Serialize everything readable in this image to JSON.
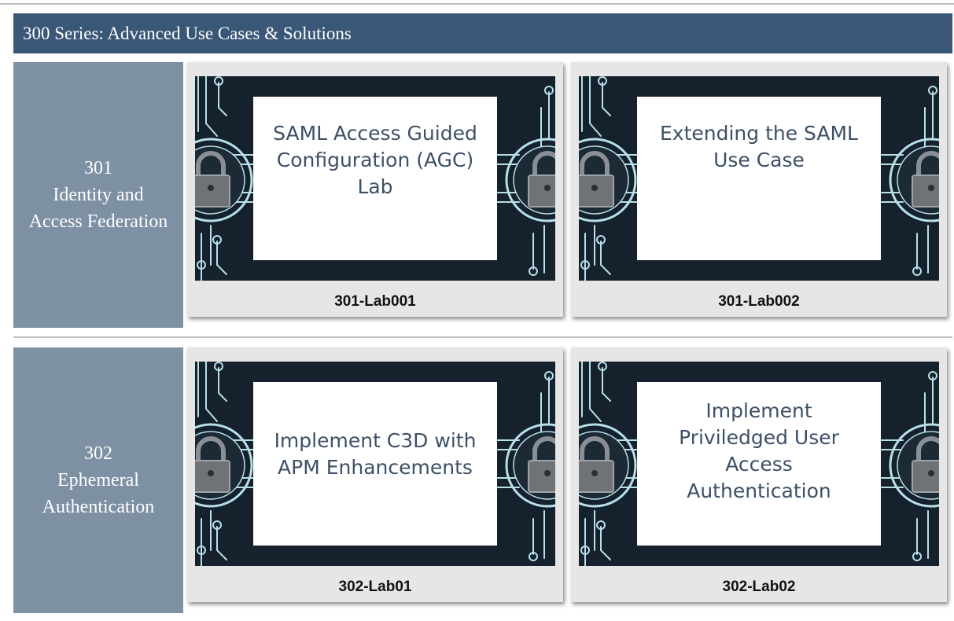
{
  "header": {
    "title": "300 Series: Advanced Use Cases & Solutions"
  },
  "courses": [
    {
      "number": "301",
      "name_line1": "Identity and",
      "name_line2": "Access Federation",
      "labs": [
        {
          "slide_lines": [
            "SAML Access Guided",
            "Configuration (AGC)",
            "Lab"
          ],
          "caption": "301-Lab001"
        },
        {
          "slide_lines": [
            "Extending the SAML",
            "Use Case"
          ],
          "caption": "301-Lab002"
        }
      ]
    },
    {
      "number": "302",
      "name_line1": "Ephemeral",
      "name_line2": "Authentication",
      "labs": [
        {
          "slide_lines": [
            "Implement C3D with",
            "APM Enhancements"
          ],
          "caption": "302-Lab01"
        },
        {
          "slide_lines": [
            "Implement",
            "Priviledged User",
            "Access",
            "Authentication"
          ],
          "caption": "302-Lab02"
        }
      ]
    }
  ],
  "colors": {
    "header_bg": "#3b5778",
    "course_label_bg": "#7d90a4",
    "card_bg": "#e6e6e6",
    "circuit": "#b8e0e6"
  },
  "icons": [
    "padlock-icon",
    "circuit-graphic"
  ]
}
